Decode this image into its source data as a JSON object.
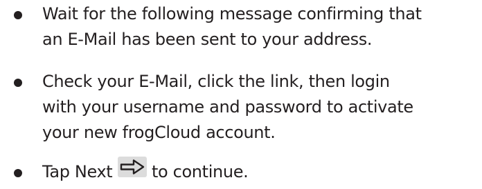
{
  "instructions": [
    {
      "lines": [
        "Wait for the following message confirming that",
        "an E-Mail has been sent to your address."
      ]
    },
    {
      "lines": [
        "Check your E-Mail, click the link, then login",
        "with your username and password to activate",
        "your new frogCloud account."
      ]
    },
    {
      "prefix": "Tap Next",
      "icon": "next-arrow-icon",
      "suffix": "to continue."
    }
  ]
}
